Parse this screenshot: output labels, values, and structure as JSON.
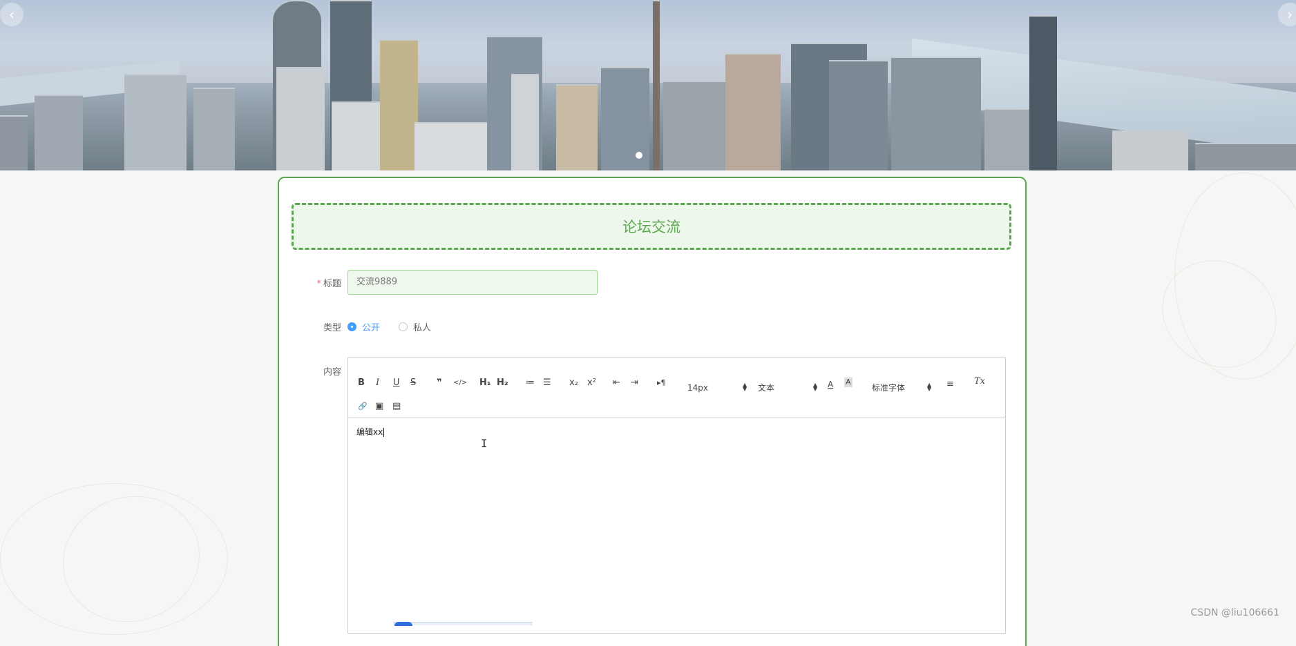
{
  "banner": {
    "prev_icon": "chevron-left-icon",
    "next_icon": "chevron-right-icon",
    "prev_label": "‹",
    "next_label": "›"
  },
  "form": {
    "heading": "论坛交流",
    "title_label": "标题",
    "required_mark": "*",
    "title_value": "交流9889",
    "type_label": "类型",
    "type_options": [
      {
        "label": "公开",
        "selected": true
      },
      {
        "label": "私人",
        "selected": false
      }
    ],
    "content_label": "内容"
  },
  "editor": {
    "toolbar": {
      "bold": "B",
      "italic": "I",
      "underline": "U",
      "strike": "S",
      "blockquote": "❞",
      "code": "</>",
      "h1": "H₁",
      "h2": "H₂",
      "ordered_list": "≔",
      "bullet_list": "☰",
      "subscript": "x₂",
      "superscript": "x²",
      "outdent": "⇤",
      "indent": "⇥",
      "direction": "▸¶",
      "size": "14px",
      "header_select": "文本",
      "font_color": "A",
      "background_color": "A",
      "font_family": "标准字体",
      "align": "≡",
      "clean": "Tx",
      "link": "🔗",
      "image": "▣",
      "video": "▤"
    },
    "content_text": "编辑xx"
  },
  "watermark": "CSDN @liu106661",
  "colors": {
    "accent_green": "#56a84a",
    "radio_blue": "#409eff",
    "required_red": "#f56c6c"
  }
}
